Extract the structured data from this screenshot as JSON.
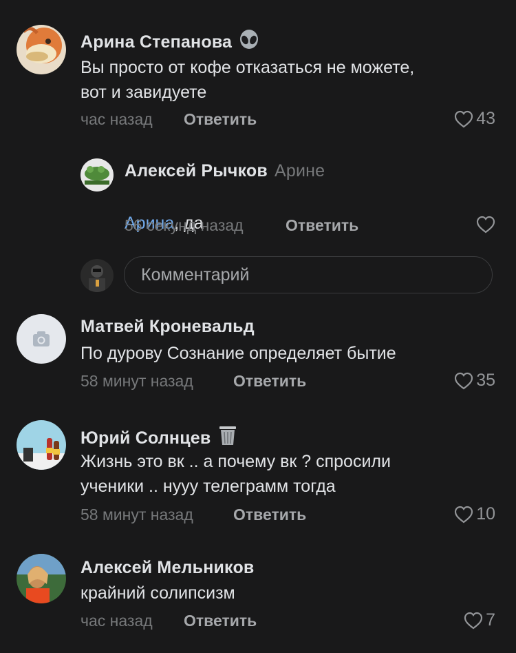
{
  "comments": [
    {
      "author": "Арина Степанова",
      "badge_icon": "alien-emoji-icon",
      "text": "Вы просто от кофе отказаться не можете,\nвот и завидуете",
      "time": "час назад",
      "reply_label": "Ответить",
      "likes": "43"
    },
    {
      "author": "Матвей Кроневальд",
      "text": "По дурову Сознание определяет бытие",
      "time": "58 минут назад",
      "reply_label": "Ответить",
      "likes": "35"
    },
    {
      "author": "Юрий Солнцев",
      "badge_icon": "trash-can-emoji-icon",
      "text": "Жизнь это вк .. а почему вк ? спросили\nученики .. нууу телеграмм тогда",
      "time": "58 минут назад",
      "reply_label": "Ответить",
      "likes": "10"
    },
    {
      "author": "Алексей Мельников",
      "text": "крайний солипсизм",
      "time": "час назад",
      "reply_label": "Ответить",
      "likes": "7"
    }
  ],
  "reply": {
    "author": "Алексей Рычков",
    "reply_to": "Арине",
    "mention": "Арина",
    "text_after": ", да",
    "time": "56 секунд назад",
    "reply_label": "Ответить",
    "likes": ""
  },
  "comment_input": {
    "placeholder": "Комментарий"
  },
  "colors": {
    "background": "#19191a",
    "text": "#e1e3e6",
    "secondary": "#76787a",
    "mention": "#71aaeb"
  }
}
